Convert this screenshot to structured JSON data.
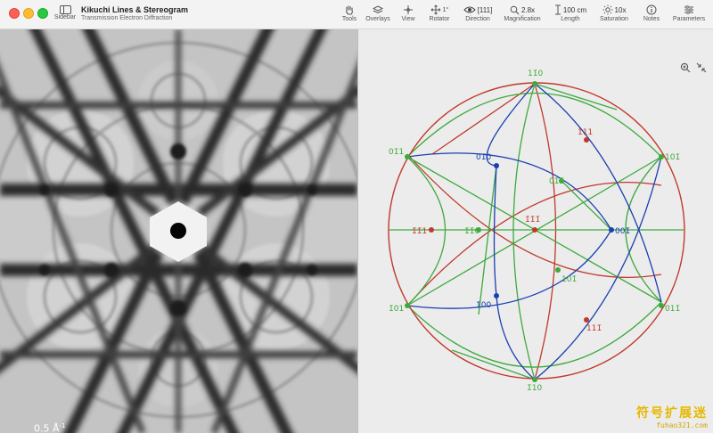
{
  "window": {
    "title": "Kikuchi Lines & Stereogram",
    "subtitle": "Transmission Electron Diffraction"
  },
  "toolbar": {
    "sidebar_label": "Sidebar",
    "tools_label": "Tools",
    "overlays_label": "Overlays",
    "view_label": "View",
    "rotator_label": "Rotator",
    "rotator_value": "1°",
    "direction_label": "Direction",
    "direction_value": "[111]",
    "magnification_label": "Magnification",
    "magnification_value": "2.8x",
    "length_label": "Length",
    "length_value": "100 cm",
    "saturation_label": "Saturation",
    "saturation_value": "10x",
    "notes_label": "Notes",
    "parameters_label": "Parameters"
  },
  "kikuchi": {
    "scale_value": "0.5 Å",
    "scale_exp": "-1"
  },
  "stereogram": {
    "colors": {
      "red": "#c0392b",
      "green": "#3daa3d",
      "blue": "#1a3fb0",
      "circle": "#c0392b"
    },
    "poles": {
      "p110_top": "11̄0",
      "p011": "01̄1",
      "p101": "101̄",
      "p111_top": "1̄11",
      "p010": "01̄0",
      "p011b": "01̄1̄",
      "p111_center": "1̄1̄1̄",
      "p110_mid": "1̄1̄0",
      "p111_left": "1̄1̄1",
      "p001": "001̄",
      "p101b": "1̄01",
      "p011c": "01̄1̄",
      "p100": "1̄00",
      "p101c": "101̄",
      "p111_bottom": "111̄",
      "p110_bottom": "1̄10",
      "p011_right": "011̄"
    }
  },
  "watermark": {
    "cn": "符号扩展迷",
    "en": "fuhao321.com"
  }
}
